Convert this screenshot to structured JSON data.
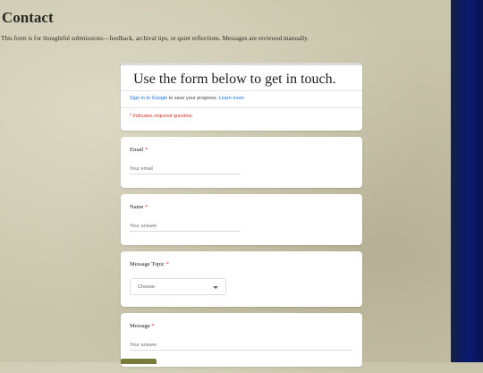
{
  "page": {
    "title": "Contact",
    "intro": "This form is for thoughtful submissions—feedback, archival tips, or quiet reflections. Messages are reviewed manually."
  },
  "form": {
    "title": "Use the form below to get in touch.",
    "signin_link": "Sign in to Google",
    "signin_text": " to save your progress. ",
    "learn_more": "Learn more",
    "required_note": "* Indicates required question",
    "fields": {
      "email": {
        "label": "Email",
        "required_mark": "*",
        "placeholder": "Your email"
      },
      "name": {
        "label": "Name",
        "required_mark": "*",
        "placeholder": "Your answer"
      },
      "topic": {
        "label": "Message Topic",
        "required_mark": "*",
        "value": "Choose"
      },
      "message": {
        "label": "Message",
        "required_mark": "*",
        "placeholder": "Your answer"
      }
    }
  },
  "colors": {
    "background": "#c9c5ac",
    "link": "#1a73e8",
    "required": "#d93025",
    "edge": "#0a1a70"
  },
  "icons": {
    "dropdown": "chevron-down-icon"
  }
}
